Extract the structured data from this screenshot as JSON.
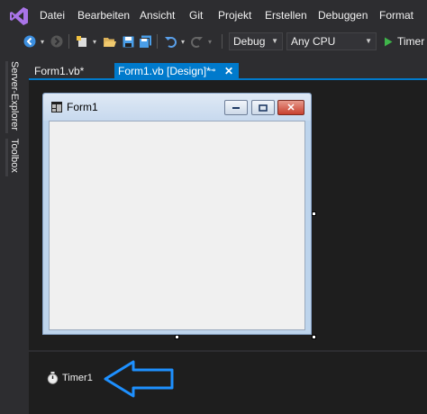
{
  "menu": [
    "Datei",
    "Bearbeiten",
    "Ansicht",
    "Git",
    "Projekt",
    "Erstellen",
    "Debuggen",
    "Format"
  ],
  "toolbar": {
    "config_combo": "Debug",
    "platform_combo": "Any CPU",
    "start_label": "Timer"
  },
  "sidebar": {
    "server_explorer": "Server-Explorer",
    "toolbox": "Toolbox"
  },
  "tabs": {
    "code_tab": "Form1.vb*",
    "design_tab": "Form1.vb [Design]*"
  },
  "form": {
    "title": "Form1"
  },
  "tray": {
    "component_label": "Timer1"
  },
  "colors": {
    "accent": "#007acc",
    "arrow": "#1e90ff",
    "chrome": "#2d2d30",
    "editor": "#1e1e1e"
  },
  "icons": [
    "vs-logo-icon",
    "back-icon",
    "forward-icon",
    "new-project-icon",
    "open-folder-icon",
    "save-icon",
    "save-all-icon",
    "undo-icon",
    "redo-icon",
    "start-icon",
    "pin-icon",
    "close-icon",
    "form-icon",
    "minimize-icon",
    "maximize-icon",
    "timer-icon",
    "arrow-annotation-icon"
  ]
}
